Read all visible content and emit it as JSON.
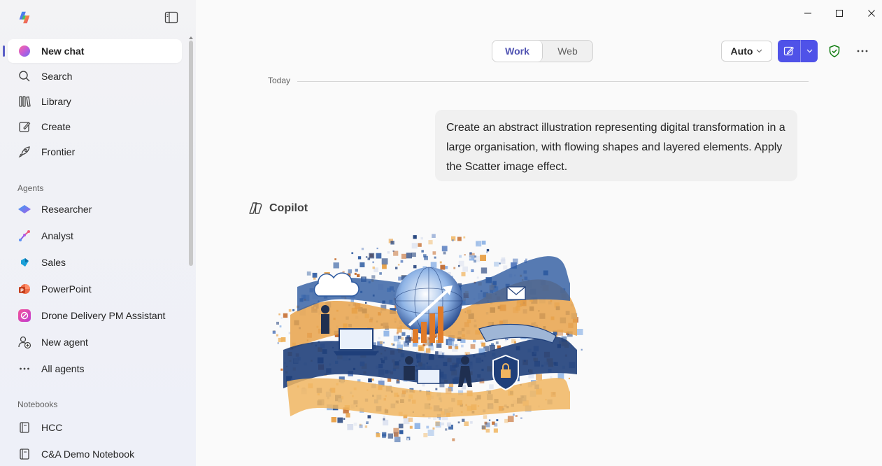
{
  "window": {
    "minimize_label": "Minimize",
    "maximize_label": "Maximize",
    "close_label": "Close"
  },
  "sidebar": {
    "nav": [
      {
        "label": "New chat",
        "icon": "copilot-color-icon"
      },
      {
        "label": "Search",
        "icon": "search-icon"
      },
      {
        "label": "Library",
        "icon": "library-icon"
      },
      {
        "label": "Create",
        "icon": "create-icon"
      },
      {
        "label": "Frontier",
        "icon": "rocket-icon"
      }
    ],
    "agents_label": "Agents",
    "agents": [
      {
        "label": "Researcher",
        "icon": "researcher-icon"
      },
      {
        "label": "Analyst",
        "icon": "analyst-icon"
      },
      {
        "label": "Sales",
        "icon": "sales-icon"
      },
      {
        "label": "PowerPoint",
        "icon": "powerpoint-icon"
      },
      {
        "label": "Drone Delivery PM Assistant",
        "icon": "drone-agent-icon"
      },
      {
        "label": "New agent",
        "icon": "new-agent-icon"
      },
      {
        "label": "All agents",
        "icon": "ellipsis-icon"
      }
    ],
    "notebooks_label": "Notebooks",
    "notebooks": [
      {
        "label": "HCC",
        "icon": "notebook-icon"
      },
      {
        "label": "C&A Demo Notebook",
        "icon": "notebook-icon"
      }
    ]
  },
  "header": {
    "mode_work": "Work",
    "mode_web": "Web",
    "model_label": "Auto"
  },
  "chat": {
    "date_divider": "Today",
    "user_message": "Create an abstract illustration representing digital transformation in a large organisation, with flowing shapes and layered elements. Apply the Scatter image effect.",
    "assistant_name": "Copilot"
  },
  "colors": {
    "accent": "#4f52e8",
    "work_text": "#4f52b2",
    "shield_green": "#107c10"
  }
}
